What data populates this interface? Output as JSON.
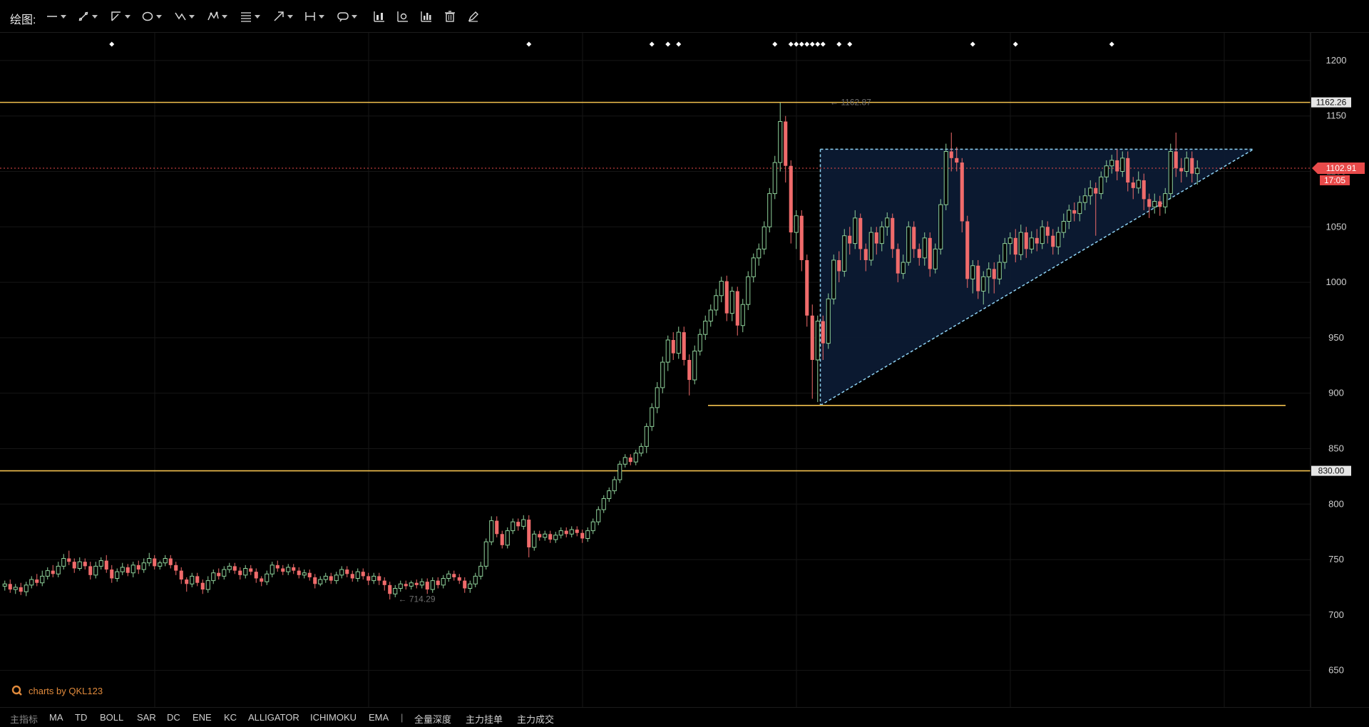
{
  "toolbar": {
    "label": "绘图:",
    "tools": [
      {
        "name": "line-tool-icon"
      },
      {
        "name": "pen-tool-icon"
      },
      {
        "name": "channel-tool-icon"
      },
      {
        "name": "ellipse-tool-icon"
      },
      {
        "name": "wave-tool-icon"
      },
      {
        "name": "pattern-tool-icon"
      },
      {
        "name": "fibonacci-tool-icon"
      },
      {
        "name": "arrow-tool-icon"
      },
      {
        "name": "measure-tool-icon"
      },
      {
        "name": "comment-tool-icon"
      }
    ],
    "actions": [
      {
        "name": "candlestick-icon"
      },
      {
        "name": "chart-settings-icon"
      },
      {
        "name": "bar-chart-icon"
      },
      {
        "name": "trash-icon"
      },
      {
        "name": "edit-pen-icon"
      }
    ]
  },
  "bottom_bar": {
    "main_indicator_label": "主指标",
    "indicators": [
      "MA",
      "TD",
      "BOLL",
      "SAR",
      "DC",
      "ENE",
      "KC",
      "ALLIGATOR",
      "ICHIMOKU",
      "EMA"
    ],
    "separator": "|",
    "extras": [
      "全量深度",
      "主力挂单",
      "主力成交"
    ]
  },
  "watermark": {
    "text": "charts by QKL123"
  },
  "colors": {
    "up": "#8fd19a",
    "down": "#f06b6b",
    "level_line": "#f2c14e",
    "triangle_outline": "#8fd3f4",
    "triangle_fill": "#0c1a33",
    "price_tag": "#e84a4a"
  },
  "chart_data": {
    "type": "candlestick",
    "ylim": [
      617,
      1225
    ],
    "y_ticks": [
      650,
      700,
      750,
      800,
      850,
      900,
      950,
      1000,
      1050,
      1100,
      1150,
      1200
    ],
    "y_tick_labels": [
      "650",
      "700",
      "750",
      "800",
      "850",
      "900",
      "950",
      "1000",
      "1050",
      "1100",
      "1150",
      "1200"
    ],
    "current_price": {
      "value": 1102.91,
      "label": "1102.91",
      "countdown": "17:05"
    },
    "high_marker": {
      "value": 1162.87,
      "label": "← 1162.87"
    },
    "low_marker": {
      "value": 714.29,
      "label": "← 714.29"
    },
    "horizontal_levels": [
      {
        "value": 1162.26,
        "label": "1162.26"
      },
      {
        "value": 830.0,
        "label": "830.00"
      }
    ],
    "segment_levels": [
      {
        "value": 889,
        "from_bar": 132,
        "to_bar": 240
      }
    ],
    "ascending_triangle": {
      "apex_value": 1120,
      "top_left_bar": 153,
      "top_right_bar": 234,
      "bottom_left_value": 889
    },
    "event_marker_bars": [
      20,
      98,
      121,
      124,
      126,
      144,
      147,
      148,
      149,
      150,
      151,
      152,
      153,
      156,
      158,
      181,
      189,
      207
    ],
    "candles": [
      [
        726,
        728,
        731,
        722
      ],
      [
        728,
        723,
        732,
        720
      ],
      [
        723,
        725,
        728,
        719
      ],
      [
        725,
        721,
        729,
        718
      ],
      [
        721,
        727,
        730,
        717
      ],
      [
        727,
        732,
        735,
        724
      ],
      [
        732,
        729,
        737,
        726
      ],
      [
        729,
        735,
        740,
        726
      ],
      [
        735,
        740,
        743,
        732
      ],
      [
        740,
        737,
        745,
        734
      ],
      [
        737,
        744,
        748,
        734
      ],
      [
        744,
        751,
        755,
        741
      ],
      [
        751,
        748,
        758,
        745
      ],
      [
        748,
        742,
        751,
        738
      ],
      [
        742,
        748,
        752,
        740
      ],
      [
        748,
        744,
        751,
        741
      ],
      [
        744,
        736,
        748,
        732
      ],
      [
        736,
        744,
        748,
        733
      ],
      [
        744,
        749,
        752,
        741
      ],
      [
        749,
        741,
        754,
        738
      ],
      [
        741,
        733,
        745,
        729
      ],
      [
        733,
        739,
        742,
        730
      ],
      [
        739,
        743,
        747,
        736
      ],
      [
        743,
        738,
        746,
        735
      ],
      [
        738,
        745,
        748,
        734
      ],
      [
        745,
        741,
        749,
        737
      ],
      [
        741,
        747,
        751,
        738
      ],
      [
        747,
        751,
        756,
        744
      ],
      [
        751,
        744,
        754,
        741
      ],
      [
        744,
        747,
        749,
        741
      ],
      [
        747,
        751,
        754,
        744
      ],
      [
        751,
        745,
        754,
        742
      ],
      [
        745,
        740,
        748,
        736
      ],
      [
        740,
        732,
        743,
        728
      ],
      [
        732,
        728,
        734,
        721
      ],
      [
        728,
        735,
        738,
        725
      ],
      [
        735,
        729,
        738,
        726
      ],
      [
        729,
        723,
        732,
        719
      ],
      [
        723,
        731,
        735,
        720
      ],
      [
        731,
        738,
        741,
        728
      ],
      [
        738,
        735,
        742,
        732
      ],
      [
        735,
        741,
        744,
        732
      ],
      [
        741,
        744,
        747,
        738
      ],
      [
        744,
        740,
        747,
        737
      ],
      [
        740,
        736,
        743,
        732
      ],
      [
        736,
        742,
        745,
        733
      ],
      [
        742,
        739,
        745,
        736
      ],
      [
        739,
        733,
        742,
        729
      ],
      [
        733,
        730,
        735,
        726
      ],
      [
        730,
        737,
        740,
        727
      ],
      [
        737,
        745,
        748,
        734
      ],
      [
        745,
        742,
        749,
        739
      ],
      [
        742,
        739,
        745,
        736
      ],
      [
        739,
        743,
        746,
        736
      ],
      [
        743,
        740,
        746,
        737
      ],
      [
        740,
        736,
        743,
        733
      ],
      [
        736,
        738,
        741,
        733
      ],
      [
        738,
        734,
        741,
        731
      ],
      [
        734,
        728,
        737,
        724
      ],
      [
        728,
        732,
        735,
        726
      ],
      [
        732,
        735,
        738,
        729
      ],
      [
        735,
        731,
        738,
        728
      ],
      [
        731,
        736,
        739,
        728
      ],
      [
        736,
        741,
        744,
        733
      ],
      [
        741,
        737,
        744,
        734
      ],
      [
        737,
        733,
        740,
        730
      ],
      [
        733,
        739,
        742,
        730
      ],
      [
        739,
        735,
        742,
        732
      ],
      [
        735,
        731,
        738,
        727
      ],
      [
        731,
        735,
        738,
        728
      ],
      [
        735,
        731,
        738,
        727
      ],
      [
        731,
        727,
        734,
        722
      ],
      [
        727,
        719,
        730,
        714
      ],
      [
        719,
        724,
        727,
        716
      ],
      [
        724,
        728,
        731,
        721
      ],
      [
        728,
        726,
        731,
        723
      ],
      [
        726,
        729,
        731,
        723
      ],
      [
        729,
        727,
        732,
        724
      ],
      [
        727,
        730,
        733,
        724
      ],
      [
        730,
        723,
        733,
        719
      ],
      [
        723,
        731,
        734,
        720
      ],
      [
        731,
        727,
        734,
        724
      ],
      [
        727,
        733,
        736,
        724
      ],
      [
        733,
        737,
        740,
        730
      ],
      [
        737,
        734,
        740,
        731
      ],
      [
        734,
        731,
        737,
        728
      ],
      [
        731,
        724,
        734,
        720
      ],
      [
        724,
        728,
        731,
        720
      ],
      [
        728,
        735,
        738,
        725
      ],
      [
        735,
        744,
        748,
        732
      ],
      [
        744,
        766,
        769,
        741
      ],
      [
        766,
        785,
        789,
        763
      ],
      [
        785,
        773,
        789,
        770
      ],
      [
        773,
        763,
        776,
        760
      ],
      [
        763,
        776,
        779,
        760
      ],
      [
        776,
        784,
        787,
        773
      ],
      [
        784,
        780,
        787,
        776
      ],
      [
        780,
        786,
        790,
        777
      ],
      [
        786,
        761,
        790,
        752
      ],
      [
        761,
        773,
        776,
        758
      ],
      [
        773,
        770,
        776,
        767
      ],
      [
        770,
        773,
        776,
        767
      ],
      [
        773,
        768,
        776,
        765
      ],
      [
        768,
        772,
        775,
        765
      ],
      [
        772,
        776,
        779,
        769
      ],
      [
        776,
        773,
        779,
        770
      ],
      [
        773,
        777,
        780,
        770
      ],
      [
        777,
        774,
        780,
        771
      ],
      [
        774,
        769,
        777,
        765
      ],
      [
        769,
        776,
        779,
        766
      ],
      [
        776,
        784,
        787,
        773
      ],
      [
        784,
        795,
        798,
        781
      ],
      [
        795,
        805,
        808,
        792
      ],
      [
        805,
        812,
        815,
        802
      ],
      [
        812,
        822,
        825,
        809
      ],
      [
        822,
        836,
        839,
        819
      ],
      [
        836,
        842,
        845,
        833
      ],
      [
        842,
        838,
        845,
        835
      ],
      [
        838,
        846,
        849,
        835
      ],
      [
        846,
        852,
        855,
        843
      ],
      [
        852,
        870,
        873,
        846
      ],
      [
        870,
        887,
        891,
        866
      ],
      [
        887,
        905,
        910,
        882
      ],
      [
        905,
        928,
        933,
        900
      ],
      [
        928,
        948,
        952,
        920
      ],
      [
        948,
        936,
        955,
        930
      ],
      [
        936,
        955,
        960,
        931
      ],
      [
        955,
        930,
        960,
        925
      ],
      [
        930,
        912,
        935,
        898
      ],
      [
        912,
        938,
        943,
        908
      ],
      [
        938,
        953,
        958,
        934
      ],
      [
        953,
        965,
        970,
        948
      ],
      [
        965,
        975,
        980,
        960
      ],
      [
        975,
        988,
        994,
        970
      ],
      [
        988,
        1001,
        1005,
        982
      ],
      [
        1001,
        972,
        1006,
        965
      ],
      [
        972,
        992,
        996,
        965
      ],
      [
        992,
        961,
        996,
        952
      ],
      [
        961,
        980,
        985,
        955
      ],
      [
        980,
        1005,
        1010,
        975
      ],
      [
        1005,
        1022,
        1026,
        1000
      ],
      [
        1022,
        1030,
        1035,
        1015
      ],
      [
        1030,
        1050,
        1055,
        1025
      ],
      [
        1050,
        1080,
        1085,
        1045
      ],
      [
        1080,
        1108,
        1114,
        1075
      ],
      [
        1108,
        1145,
        1162,
        1100
      ],
      [
        1145,
        1105,
        1150,
        1090
      ],
      [
        1105,
        1045,
        1110,
        1035
      ],
      [
        1045,
        1060,
        1065,
        1030
      ],
      [
        1060,
        1020,
        1065,
        1010
      ],
      [
        1020,
        970,
        1025,
        960
      ],
      [
        970,
        930,
        980,
        895
      ],
      [
        930,
        965,
        970,
        892
      ],
      [
        965,
        945,
        970,
        930
      ],
      [
        945,
        985,
        990,
        940
      ],
      [
        985,
        1020,
        1025,
        980
      ],
      [
        1020,
        1010,
        1028,
        1000
      ],
      [
        1010,
        1042,
        1048,
        1005
      ],
      [
        1042,
        1035,
        1050,
        1025
      ],
      [
        1035,
        1058,
        1065,
        1030
      ],
      [
        1058,
        1030,
        1062,
        1020
      ],
      [
        1030,
        1020,
        1035,
        1010
      ],
      [
        1020,
        1045,
        1050,
        1015
      ],
      [
        1045,
        1035,
        1050,
        1025
      ],
      [
        1035,
        1050,
        1055,
        1028
      ],
      [
        1050,
        1058,
        1063,
        1042
      ],
      [
        1058,
        1030,
        1062,
        1022
      ],
      [
        1030,
        1008,
        1035,
        1000
      ],
      [
        1008,
        1018,
        1025,
        1003
      ],
      [
        1018,
        1050,
        1055,
        1015
      ],
      [
        1050,
        1030,
        1055,
        1022
      ],
      [
        1030,
        1022,
        1035,
        1015
      ],
      [
        1022,
        1040,
        1045,
        1015
      ],
      [
        1040,
        1012,
        1045,
        1005
      ],
      [
        1012,
        1030,
        1035,
        1008
      ],
      [
        1030,
        1070,
        1075,
        1025
      ],
      [
        1070,
        1118,
        1125,
        1065
      ],
      [
        1118,
        1112,
        1135,
        1100
      ],
      [
        1112,
        1108,
        1122,
        1100
      ],
      [
        1108,
        1055,
        1112,
        1045
      ],
      [
        1055,
        1003,
        1060,
        995
      ],
      [
        1003,
        1015,
        1020,
        990
      ],
      [
        1015,
        992,
        1020,
        985
      ],
      [
        992,
        1005,
        1010,
        980
      ],
      [
        1005,
        1012,
        1018,
        990
      ],
      [
        1012,
        1003,
        1018,
        990
      ],
      [
        1003,
        1018,
        1025,
        998
      ],
      [
        1018,
        1035,
        1040,
        1012
      ],
      [
        1035,
        1040,
        1045,
        1025
      ],
      [
        1040,
        1025,
        1048,
        1018
      ],
      [
        1025,
        1045,
        1052,
        1020
      ],
      [
        1045,
        1030,
        1050,
        1022
      ],
      [
        1030,
        1040,
        1046,
        1026
      ],
      [
        1040,
        1035,
        1048,
        1028
      ],
      [
        1035,
        1050,
        1056,
        1030
      ],
      [
        1050,
        1042,
        1055,
        1035
      ],
      [
        1042,
        1032,
        1048,
        1025
      ],
      [
        1032,
        1045,
        1050,
        1025
      ],
      [
        1045,
        1055,
        1062,
        1040
      ],
      [
        1055,
        1065,
        1070,
        1048
      ],
      [
        1065,
        1062,
        1072,
        1055
      ],
      [
        1062,
        1072,
        1078,
        1055
      ],
      [
        1072,
        1078,
        1085,
        1065
      ],
      [
        1078,
        1085,
        1092,
        1070
      ],
      [
        1085,
        1080,
        1090,
        1042
      ],
      [
        1080,
        1095,
        1100,
        1075
      ],
      [
        1095,
        1105,
        1110,
        1090
      ],
      [
        1105,
        1110,
        1115,
        1098
      ],
      [
        1110,
        1100,
        1120,
        1092
      ],
      [
        1100,
        1112,
        1118,
        1095
      ],
      [
        1112,
        1090,
        1118,
        1082
      ],
      [
        1090,
        1085,
        1095,
        1075
      ],
      [
        1085,
        1092,
        1100,
        1080
      ],
      [
        1092,
        1075,
        1098,
        1065
      ],
      [
        1075,
        1068,
        1080,
        1058
      ],
      [
        1068,
        1073,
        1080,
        1062
      ],
      [
        1073,
        1068,
        1078,
        1060
      ],
      [
        1068,
        1080,
        1085,
        1062
      ],
      [
        1080,
        1118,
        1125,
        1075
      ],
      [
        1118,
        1103,
        1135,
        1095
      ],
      [
        1103,
        1100,
        1112,
        1090
      ],
      [
        1100,
        1112,
        1118,
        1095
      ],
      [
        1112,
        1098,
        1118,
        1090
      ],
      [
        1098,
        1102.91,
        1110,
        1088
      ]
    ]
  }
}
